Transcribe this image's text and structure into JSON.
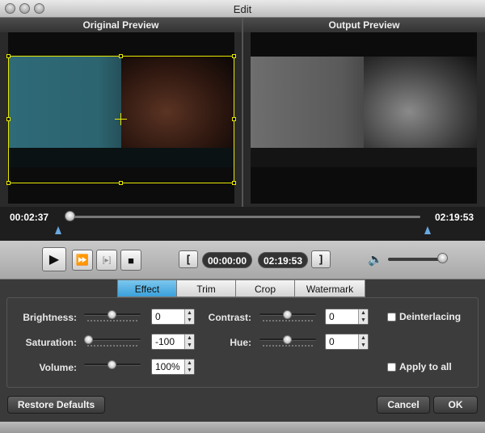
{
  "window": {
    "title": "Edit"
  },
  "preview": {
    "original_label": "Original Preview",
    "output_label": "Output Preview"
  },
  "timeline": {
    "current_time": "00:02:37",
    "end_time": "02:19:53",
    "progress": 0.0187
  },
  "controls": {
    "play_icon": "play-icon",
    "step_icon": "fast-forward-icon",
    "frame_icon": "frame-step-icon",
    "stop_icon": "stop-icon",
    "start_time": "00:00:00",
    "end_time": "02:19:53",
    "start_bracket": "[",
    "end_bracket": "]",
    "volume_icon": "speaker-icon",
    "volume_level": 0.9
  },
  "tabs": [
    "Effect",
    "Trim",
    "Crop",
    "Watermark"
  ],
  "active_tab": "Effect",
  "effect": {
    "brightness": {
      "label": "Brightness:",
      "value": "0"
    },
    "saturation": {
      "label": "Saturation:",
      "value": "-100"
    },
    "volume": {
      "label": "Volume:",
      "value": "100%"
    },
    "contrast": {
      "label": "Contrast:",
      "value": "0"
    },
    "hue": {
      "label": "Hue:",
      "value": "0"
    },
    "deinterlacing": {
      "label": "Deinterlacing",
      "checked": false
    },
    "apply_all": {
      "label": "Apply to all",
      "checked": false
    }
  },
  "footer": {
    "restore": "Restore Defaults",
    "cancel": "Cancel",
    "ok": "OK"
  },
  "colors": {
    "accent": "#3aa0db",
    "crop_frame": "#e8e800"
  }
}
